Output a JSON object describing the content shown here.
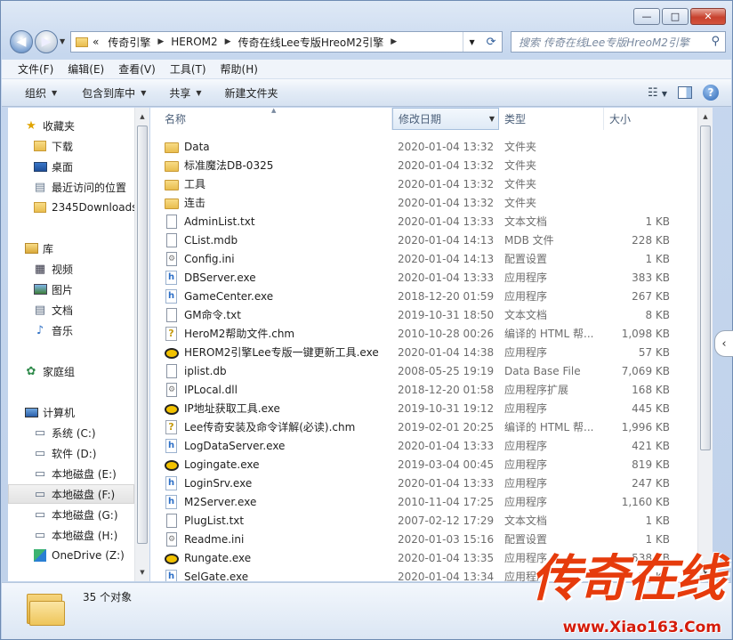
{
  "window": {
    "minimize_label": "—",
    "maximize_label": "□",
    "close_label": "✕"
  },
  "address": {
    "overflow": "«",
    "breadcrumbs": [
      "传奇引擎",
      "HEROM2",
      "传奇在线Lee专版HreoM2引擎"
    ],
    "search_placeholder": "搜索 传奇在线Lee专版HreoM2引擎"
  },
  "menubar": {
    "items": [
      "文件(F)",
      "编辑(E)",
      "查看(V)",
      "工具(T)",
      "帮助(H)"
    ]
  },
  "toolbar": {
    "organize": "组织",
    "include_in_library": "包含到库中",
    "share": "共享",
    "new_folder": "新建文件夹"
  },
  "nav": {
    "favorites": "收藏夹",
    "favorites_items": [
      "下载",
      "桌面",
      "最近访问的位置",
      "2345Downloads"
    ],
    "libraries": "库",
    "libraries_items": [
      "视频",
      "图片",
      "文档",
      "音乐"
    ],
    "homegroup": "家庭组",
    "computer": "计算机",
    "drives": [
      "系统 (C:)",
      "软件 (D:)",
      "本地磁盘 (E:)",
      "本地磁盘 (F:)",
      "本地磁盘 (G:)",
      "本地磁盘 (H:)",
      "OneDrive (Z:)"
    ],
    "selected_drive": "本地磁盘 (F:)"
  },
  "columns": {
    "name": "名称",
    "date": "修改日期",
    "type": "类型",
    "size": "大小"
  },
  "files": [
    {
      "name": "Data",
      "date": "2020-01-04 13:32",
      "type": "文件夹",
      "size": "",
      "icon": "folder"
    },
    {
      "name": "标准魔法DB-0325",
      "date": "2020-01-04 13:32",
      "type": "文件夹",
      "size": "",
      "icon": "folder"
    },
    {
      "name": "工具",
      "date": "2020-01-04 13:32",
      "type": "文件夹",
      "size": "",
      "icon": "folder"
    },
    {
      "name": "连击",
      "date": "2020-01-04 13:32",
      "type": "文件夹",
      "size": "",
      "icon": "folder"
    },
    {
      "name": "AdminList.txt",
      "date": "2020-01-04 13:33",
      "type": "文本文档",
      "size": "1 KB",
      "icon": "doc"
    },
    {
      "name": "CList.mdb",
      "date": "2020-01-04 14:13",
      "type": "MDB 文件",
      "size": "228 KB",
      "icon": "doc"
    },
    {
      "name": "Config.ini",
      "date": "2020-01-04 14:13",
      "type": "配置设置",
      "size": "1 KB",
      "icon": "cfg"
    },
    {
      "name": "DBServer.exe",
      "date": "2020-01-04 13:33",
      "type": "应用程序",
      "size": "383 KB",
      "icon": "exe"
    },
    {
      "name": "GameCenter.exe",
      "date": "2018-12-20 01:59",
      "type": "应用程序",
      "size": "267 KB",
      "icon": "exe"
    },
    {
      "name": "GM命令.txt",
      "date": "2019-10-31 18:50",
      "type": "文本文档",
      "size": "8 KB",
      "icon": "doc"
    },
    {
      "name": "HeroM2帮助文件.chm",
      "date": "2010-10-28 00:26",
      "type": "编译的 HTML 帮...",
      "size": "1,098 KB",
      "icon": "chm"
    },
    {
      "name": "HEROM2引擎Lee专版一键更新工具.exe",
      "date": "2020-01-04 14:38",
      "type": "应用程序",
      "size": "57 KB",
      "icon": "app"
    },
    {
      "name": "iplist.db",
      "date": "2008-05-25 19:19",
      "type": "Data Base File",
      "size": "7,069 KB",
      "icon": "doc"
    },
    {
      "name": "IPLocal.dll",
      "date": "2018-12-20 01:58",
      "type": "应用程序扩展",
      "size": "168 KB",
      "icon": "cfg"
    },
    {
      "name": "IP地址获取工具.exe",
      "date": "2019-10-31 19:12",
      "type": "应用程序",
      "size": "445 KB",
      "icon": "app"
    },
    {
      "name": "Lee传奇安装及命令详解(必读).chm",
      "date": "2019-02-01 20:25",
      "type": "编译的 HTML 帮...",
      "size": "1,996 KB",
      "icon": "chm"
    },
    {
      "name": "LogDataServer.exe",
      "date": "2020-01-04 13:33",
      "type": "应用程序",
      "size": "421 KB",
      "icon": "exe"
    },
    {
      "name": "Logingate.exe",
      "date": "2019-03-04 00:45",
      "type": "应用程序",
      "size": "819 KB",
      "icon": "app"
    },
    {
      "name": "LoginSrv.exe",
      "date": "2020-01-04 13:33",
      "type": "应用程序",
      "size": "247 KB",
      "icon": "exe"
    },
    {
      "name": "M2Server.exe",
      "date": "2010-11-04 17:25",
      "type": "应用程序",
      "size": "1,160 KB",
      "icon": "exe"
    },
    {
      "name": "PlugList.txt",
      "date": "2007-02-12 17:29",
      "type": "文本文档",
      "size": "1 KB",
      "icon": "doc"
    },
    {
      "name": "Readme.ini",
      "date": "2020-01-03 15:16",
      "type": "配置设置",
      "size": "1 KB",
      "icon": "cfg"
    },
    {
      "name": "Rungate.exe",
      "date": "2020-01-04 13:35",
      "type": "应用程序",
      "size": "538 KB",
      "icon": "app"
    },
    {
      "name": "SelGate.exe",
      "date": "2020-01-04 13:34",
      "type": "应用程序",
      "size": "21 KB",
      "icon": "exe"
    }
  ],
  "status": {
    "item_count": "35 个对象"
  },
  "watermark": {
    "title": "传奇在线",
    "url": "www.Xiao163.Com"
  }
}
